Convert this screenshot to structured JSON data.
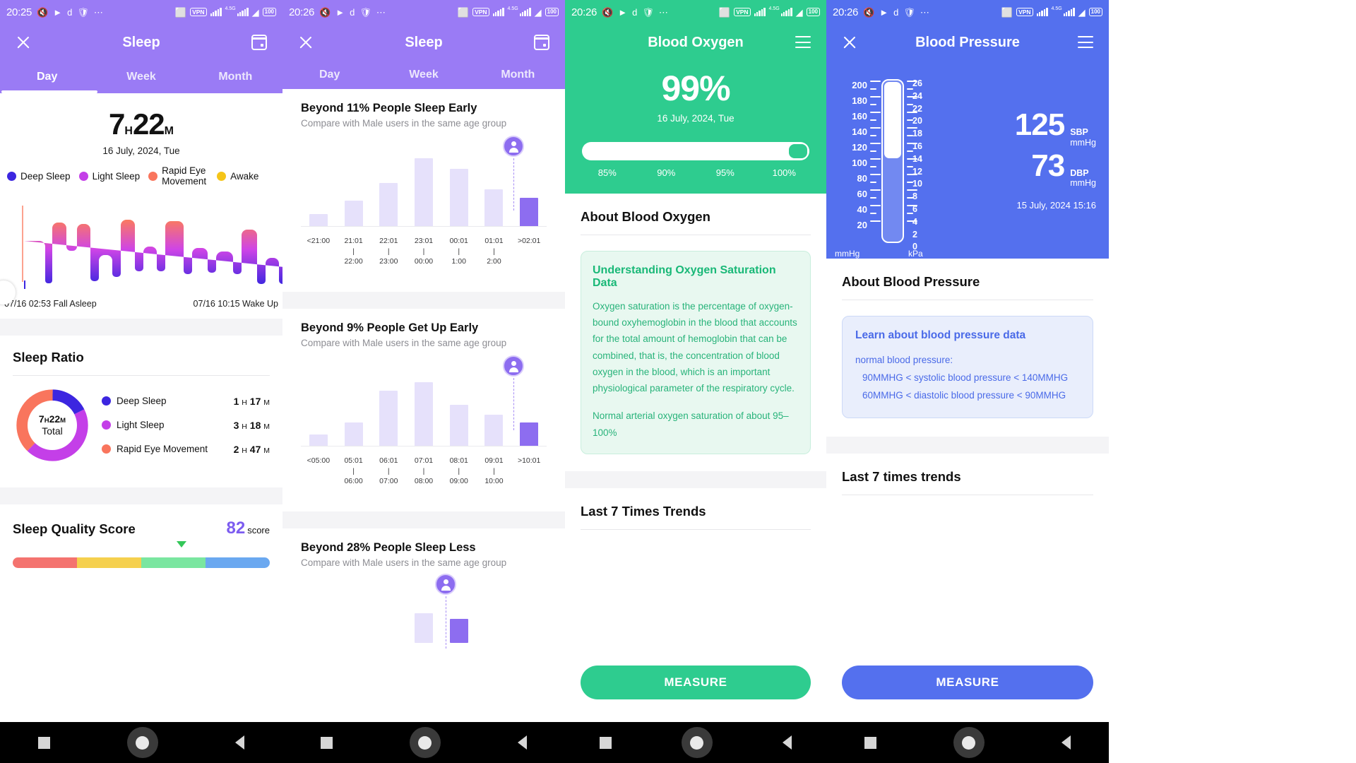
{
  "panel1": {
    "status": {
      "time": "20:25",
      "icons": [
        "mute-icon",
        "telegram-icon",
        "d-icon",
        "shield-icon",
        "more-icon"
      ],
      "right_icons": [
        "bluetooth-icon",
        "vpn-icon",
        "signal-icon",
        "signal2-icon",
        "wifi-icon",
        "battery-icon"
      ],
      "vpn": "VPN",
      "battery": "100",
      "net": "4.5G"
    },
    "appbar": {
      "title": "Sleep",
      "close": "close-icon",
      "calendar": "calendar-icon"
    },
    "tabs": [
      {
        "label": "Day",
        "active": true
      },
      {
        "label": "Week",
        "active": false
      },
      {
        "label": "Month",
        "active": false
      }
    ],
    "summary": {
      "hours": "7",
      "h_unit": "H",
      "minutes": "22",
      "m_unit": "M",
      "date": "16 July, 2024, Tue"
    },
    "legend": [
      {
        "label": "Deep Sleep",
        "color": "#3c26e0"
      },
      {
        "label": "Light Sleep",
        "color": "#c43fe8"
      },
      {
        "label": "Rapid Eye Movement",
        "color": "#f9755d"
      },
      {
        "label": "Awake",
        "color": "#f5c518"
      }
    ],
    "hypnogram": {
      "start_label": "07/16 02:53 Fall Asleep",
      "end_label": "07/16 10:15 Wake Up"
    },
    "sleep_ratio": {
      "title": "Sleep Ratio",
      "total_hours": "7",
      "total_h_unit": "H",
      "total_minutes": "22",
      "total_m_unit": "M",
      "total_word": "Total",
      "items": [
        {
          "label": "Deep Sleep",
          "color": "#3c26e0",
          "hours": "1",
          "minutes": "17",
          "h": "H",
          "m": "M",
          "pct": 17.4
        },
        {
          "label": "Light Sleep",
          "color": "#c43fe8",
          "hours": "3",
          "minutes": "18",
          "h": "H",
          "m": "M",
          "pct": 44.8
        },
        {
          "label": "Rapid Eye Movement",
          "color": "#f9755d",
          "hours": "2",
          "minutes": "47",
          "h": "H",
          "m": "M",
          "pct": 37.8
        }
      ]
    },
    "quality": {
      "title": "Sleep Quality Score",
      "score": "82",
      "score_unit": "score",
      "bands": [
        "#f4736f",
        "#f5d04e",
        "#7ae6a0",
        "#6aa8f0"
      ]
    }
  },
  "panel2": {
    "status": {
      "time": "20:26",
      "vpn": "VPN",
      "battery": "100",
      "net": "4.5G"
    },
    "appbar": {
      "title": "Sleep",
      "close": "close-icon",
      "calendar": "calendar-icon"
    },
    "tabs": [
      {
        "label": "Day",
        "active": true
      },
      {
        "label": "Week",
        "active": false
      },
      {
        "label": "Month",
        "active": false
      }
    ],
    "cards": [
      {
        "title": "Beyond 11% People Sleep Early",
        "subtitle": "Compare with Male users in the same age group",
        "labels": [
          "<21:00",
          "21:01\n22:00",
          "22:01\n23:00",
          "23:01\n00:00",
          "00:01\n1:00",
          "01:01\n2:00",
          ">02:01"
        ],
        "values": [
          14,
          30,
          50,
          78,
          66,
          43,
          33
        ],
        "me_index": 6
      },
      {
        "title": "Beyond 9% People Get Up Early",
        "subtitle": "Compare with Male users in the same age group",
        "labels": [
          "<05:00",
          "05:01\n06:00",
          "06:01\n07:00",
          "07:01\n08:00",
          "08:01\n09:00",
          "09:01\n10:00",
          ">10:01"
        ],
        "values": [
          13,
          27,
          63,
          73,
          47,
          36,
          27
        ],
        "me_index": 6
      },
      {
        "title": "Beyond 28% People Sleep Less",
        "subtitle": "Compare with Male users in the same age group",
        "labels": [
          "",
          "",
          "",
          "",
          "",
          "",
          ""
        ],
        "values": [
          0,
          0,
          0,
          42,
          34,
          0,
          0
        ],
        "me_index": 4
      }
    ]
  },
  "panel3": {
    "status": {
      "time": "20:26",
      "vpn": "VPN",
      "battery": "100",
      "net": "4.5G"
    },
    "appbar": {
      "title": "Blood Oxygen",
      "list": "list-icon"
    },
    "hero": {
      "value": "99%",
      "date": "16 July, 2024, Tue",
      "progress": 99
    },
    "scale": [
      "85%",
      "90%",
      "95%",
      "100%"
    ],
    "about_title": "About Blood Oxygen",
    "info": {
      "title": "Understanding Oxygen Saturation Data",
      "paragraphs": [
        "Oxygen saturation is the percentage of oxygen-bound oxyhemoglobin in the blood that accounts for the total amount of hemoglobin that can be combined, that is, the concentration of blood oxygen in the blood, which is an important physiological parameter of the respiratory cycle.",
        "Normal arterial oxygen saturation of about 95–100%"
      ]
    },
    "trends_title": "Last 7 Times Trends",
    "measure_label": "MEASURE",
    "accent": "#2ecc8f"
  },
  "panel4": {
    "status": {
      "time": "20:26",
      "vpn": "VPN",
      "battery": "100",
      "net": "4.5G"
    },
    "appbar": {
      "title": "Blood Pressure",
      "close": "close-icon",
      "list": "list-icon"
    },
    "gauge": {
      "left_labels": [
        "200",
        "180",
        "160",
        "140",
        "120",
        "100",
        "80",
        "60",
        "40",
        "20"
      ],
      "right_labels": [
        "26",
        "24",
        "22",
        "20",
        "18",
        "16",
        "14",
        "12",
        "10",
        "8",
        "6",
        "4",
        "2",
        "0"
      ],
      "left_unit": "mmHg",
      "right_unit": "kPa"
    },
    "reading": {
      "sbp_value": "125",
      "sbp_label": "SBP",
      "sbp_unit": "mmHg",
      "dbp_value": "73",
      "dbp_label": "DBP",
      "dbp_unit": "mmHg",
      "date": "15 July, 2024 15:16"
    },
    "about_title": "About Blood Pressure",
    "info": {
      "title": "Learn about blood pressure data",
      "line1": "normal blood pressure:",
      "line2": "90MMHG < systolic blood pressure < 140MMHG",
      "line3": "60MMHG < diastolic blood pressure < 90MMHG"
    },
    "trends_title": "Last 7 times trends",
    "measure_label": "MEASURE",
    "accent": "#5470ee"
  },
  "navbar": {
    "recent": "square-icon",
    "home": "home-circle-icon",
    "back": "back-triangle-icon"
  }
}
